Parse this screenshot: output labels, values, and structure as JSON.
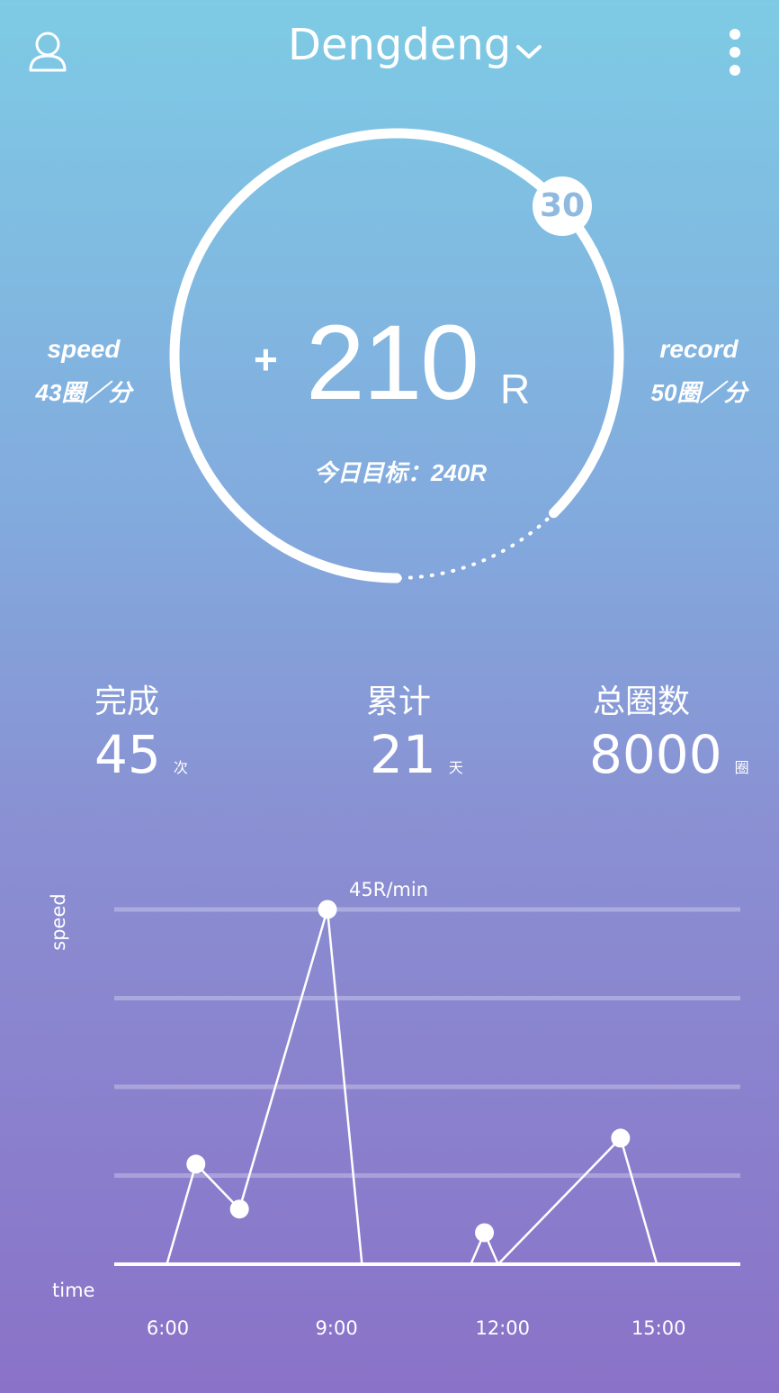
{
  "header": {
    "title": "Dengdeng",
    "icons": {
      "profile": "user-icon",
      "dropdown": "chevron-down-icon",
      "menu": "more-vertical-icon"
    }
  },
  "ring": {
    "badge": "30",
    "plus": "+",
    "value": "210",
    "unit": "R",
    "goal_label": "今日目标：240R",
    "progress_fraction": 0.875
  },
  "speed": {
    "label": "speed",
    "value": "43圈／分"
  },
  "record": {
    "label": "record",
    "value": "50圈／分"
  },
  "stats": [
    {
      "label": "完成",
      "value": "45",
      "unit": "次"
    },
    {
      "label": "累计",
      "value": "21",
      "unit": "天"
    },
    {
      "label": "总圈数",
      "value": "8000",
      "unit": "圈"
    }
  ],
  "chart_data": {
    "type": "line",
    "ylabel": "speed",
    "xlabel": "time",
    "x_ticks": [
      "6:00",
      "9:00",
      "12:00",
      "15:00"
    ],
    "ylim": [
      0,
      45
    ],
    "annotations": [
      {
        "text": "45R/min",
        "x": "8:52",
        "y": 45
      }
    ],
    "series": [
      {
        "values": [
          {
            "x": "5:55",
            "y": 0
          },
          {
            "x": "6:27",
            "y": 12.7
          },
          {
            "x": "7:15",
            "y": 7.0
          },
          {
            "x": "8:52",
            "y": 45
          },
          {
            "x": "9:30",
            "y": 0
          }
        ]
      },
      {
        "values": [
          {
            "x": "11:30",
            "y": 0
          },
          {
            "x": "11:45",
            "y": 4.0
          },
          {
            "x": "12:00",
            "y": 0
          },
          {
            "x": "14:15",
            "y": 16.0
          },
          {
            "x": "14:55",
            "y": 0
          }
        ]
      }
    ]
  }
}
